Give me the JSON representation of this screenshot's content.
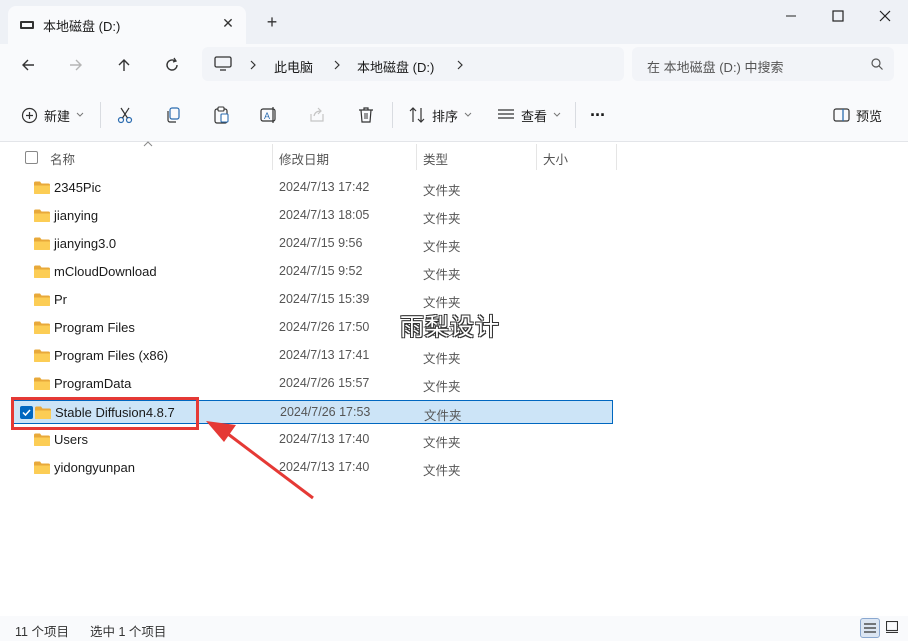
{
  "window": {
    "tab_title": "本地磁盘 (D:)",
    "tab_close": "✕",
    "new_tab": "+"
  },
  "nav": {
    "breadcrumb": [
      "此电脑",
      "本地磁盘 (D:)"
    ],
    "search_placeholder": "在 本地磁盘 (D:) 中搜索"
  },
  "toolbar": {
    "new_label": "新建",
    "sort_label": "排序",
    "view_label": "查看",
    "more_label": "···",
    "preview_label": "预览"
  },
  "columns": {
    "name": "名称",
    "date": "修改日期",
    "type": "类型",
    "size": "大小"
  },
  "files": [
    {
      "name": "2345Pic",
      "date": "2024/7/13 17:42",
      "type": "文件夹"
    },
    {
      "name": "jianying",
      "date": "2024/7/13 18:05",
      "type": "文件夹"
    },
    {
      "name": "jianying3.0",
      "date": "2024/7/15 9:56",
      "type": "文件夹"
    },
    {
      "name": "mCloudDownload",
      "date": "2024/7/15 9:52",
      "type": "文件夹"
    },
    {
      "name": "Pr",
      "date": "2024/7/15 15:39",
      "type": "文件夹"
    },
    {
      "name": "Program Files",
      "date": "2024/7/26 17:50",
      "type": "文件夹"
    },
    {
      "name": "Program Files (x86)",
      "date": "2024/7/13 17:41",
      "type": "文件夹"
    },
    {
      "name": "ProgramData",
      "date": "2024/7/26 15:57",
      "type": "文件夹"
    },
    {
      "name": "Stable Diffusion4.8.7",
      "date": "2024/7/26 17:53",
      "type": "文件夹",
      "selected": true
    },
    {
      "name": "Users",
      "date": "2024/7/13 17:40",
      "type": "文件夹"
    },
    {
      "name": "yidongyunpan",
      "date": "2024/7/13 17:40",
      "type": "文件夹"
    }
  ],
  "watermark": "雨梨设计",
  "status": {
    "count": "11 个项目",
    "selected": "选中 1 个项目"
  },
  "colors": {
    "accent": "#0067c0",
    "selection": "#cce4f7",
    "folder": "#f8c84b",
    "annotation": "#e53935"
  }
}
